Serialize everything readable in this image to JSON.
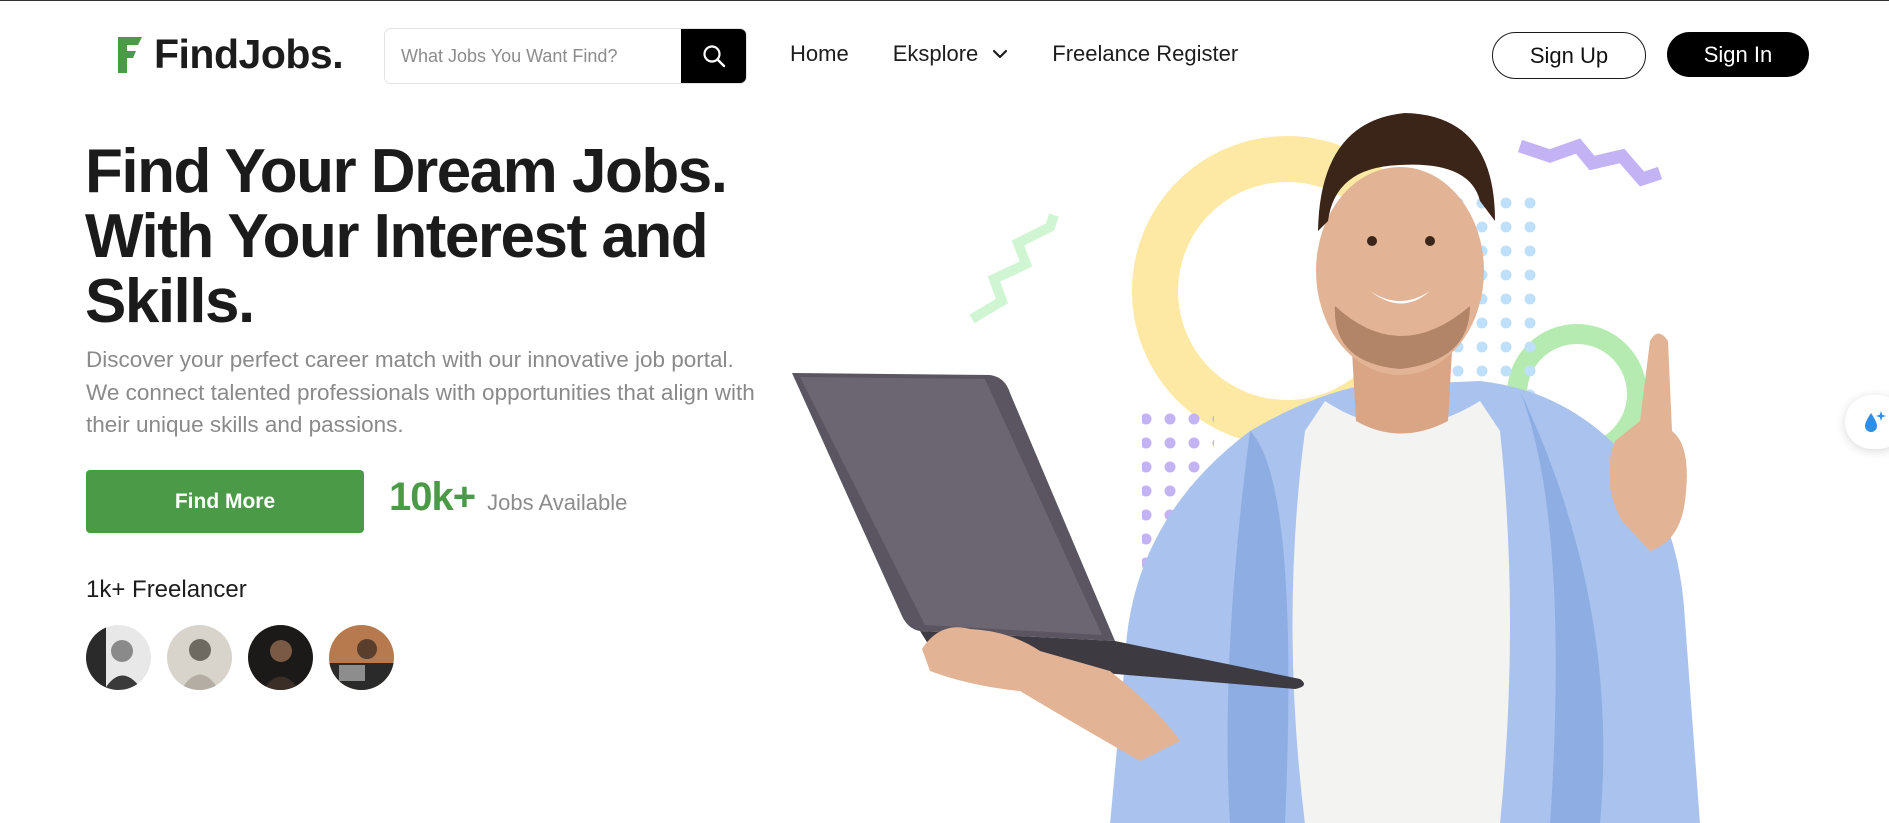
{
  "brand": {
    "name": "FindJobs.",
    "accent": "#4b9a48"
  },
  "search": {
    "placeholder": "What Jobs You Want Find?",
    "icon": "search-icon"
  },
  "nav": {
    "home": "Home",
    "explore": "Eksplore",
    "freelance": "Freelance Register"
  },
  "auth": {
    "signup": "Sign Up",
    "signin": "Sign In"
  },
  "hero": {
    "title_line1": "Find Your Dream Jobs.",
    "title_line2": "With Your Interest and",
    "title_line3": "Skills.",
    "description": "Discover your perfect career match with our innovative job portal. We connect talented professionals with opportunities that align with their unique skills and passions.",
    "cta": "Find More",
    "stat_value": "10k+",
    "stat_label": "Jobs Available",
    "freelancer_label": "1k+ Freelancer"
  },
  "avatars": [
    "freelancer-1",
    "freelancer-2",
    "freelancer-3",
    "freelancer-4"
  ],
  "colors": {
    "yellow_ring": "#fde9a3",
    "green_ring": "#b5ebb0",
    "lavender": "#c3b3f5",
    "sky_dots": "#bfe0fa",
    "mint": "#cff5d3",
    "shirt": "#a9c3ee"
  }
}
